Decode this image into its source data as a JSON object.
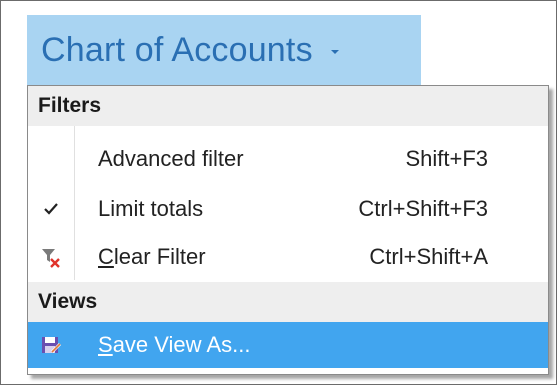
{
  "header": {
    "title": "Chart of Accounts"
  },
  "menu": {
    "sections": [
      {
        "header": "Filters",
        "items": [
          {
            "label": "Advanced filter",
            "shortcut": "Shift+F3",
            "icon": "none",
            "checked": false
          },
          {
            "label": "Limit totals",
            "shortcut": "Ctrl+Shift+F3",
            "icon": "check-icon",
            "checked": true
          },
          {
            "label_first": "C",
            "label_rest": "lear Filter",
            "shortcut": "Ctrl+Shift+A",
            "icon": "clear-filter-icon",
            "checked": false
          }
        ]
      },
      {
        "header": "Views",
        "items": [
          {
            "label_first": "S",
            "label_rest": "ave View As...",
            "icon": "save-view-icon",
            "highlighted": true
          }
        ]
      }
    ]
  },
  "colors": {
    "title_bg": "#a9d4f2",
    "title_text": "#2a6fb3",
    "section_bg": "#eeeeee",
    "highlight_bg": "#41a5ef"
  }
}
